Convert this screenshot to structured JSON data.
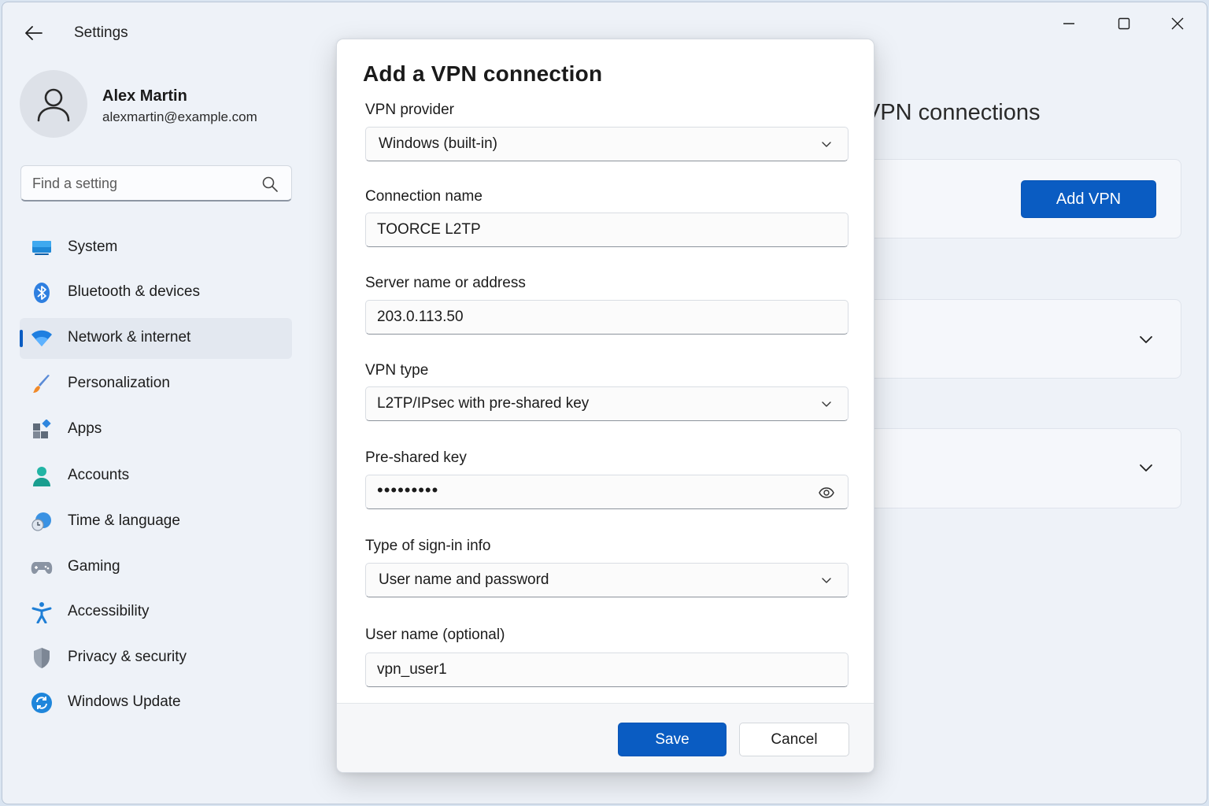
{
  "app": {
    "title": "Settings"
  },
  "profile": {
    "name": "Alex Martin",
    "email": "alexmartin@example.com"
  },
  "search": {
    "placeholder": "Find a setting"
  },
  "sidebar": {
    "items": [
      {
        "label": "System",
        "icon": "monitor-icon"
      },
      {
        "label": "Bluetooth & devices",
        "icon": "bluetooth-icon"
      },
      {
        "label": "Network & internet",
        "icon": "wifi-icon",
        "active": true
      },
      {
        "label": "Personalization",
        "icon": "brush-icon"
      },
      {
        "label": "Apps",
        "icon": "apps-icon"
      },
      {
        "label": "Accounts",
        "icon": "person-icon"
      },
      {
        "label": "Time & language",
        "icon": "clock-globe-icon"
      },
      {
        "label": "Gaming",
        "icon": "gamepad-icon"
      },
      {
        "label": "Accessibility",
        "icon": "accessibility-icon"
      },
      {
        "label": "Privacy & security",
        "icon": "shield-icon"
      },
      {
        "label": "Windows Update",
        "icon": "update-icon"
      }
    ]
  },
  "page": {
    "heading": "VPN connections",
    "add_vpn_label": "Add VPN"
  },
  "dialog": {
    "title": "Add a VPN connection",
    "vpn_provider": {
      "label": "VPN provider",
      "value": "Windows (built-in)"
    },
    "connection_name": {
      "label": "Connection name",
      "value": "TOORCE L2TP"
    },
    "server": {
      "label": "Server name or address",
      "value": "203.0.113.50"
    },
    "vpn_type": {
      "label": "VPN type",
      "value": "L2TP/IPsec with pre-shared key"
    },
    "psk": {
      "label": "Pre-shared key",
      "value": "•••••••••"
    },
    "signin_type": {
      "label": "Type of sign-in info",
      "value": "User name and password"
    },
    "username": {
      "label": "User name (optional)",
      "value": "vpn_user1"
    },
    "save_label": "Save",
    "cancel_label": "Cancel"
  },
  "colors": {
    "accent": "#0a5cc2",
    "window_bg": "#eef2f8",
    "dialog_bg": "#ffffff"
  }
}
